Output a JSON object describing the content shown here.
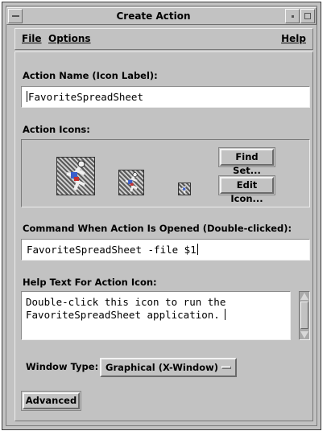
{
  "window": {
    "title": "Create Action"
  },
  "menubar": {
    "file_label": "File",
    "options_label": "Options",
    "help_label": "Help"
  },
  "form": {
    "action_name_label": "Action Name (Icon Label):",
    "action_name_value": "FavoriteSpreadSheet",
    "action_icons_label": "Action Icons:",
    "find_set_button": "Find Set...",
    "edit_icon_button": "Edit Icon...",
    "command_label": "Command When Action Is Opened (Double-clicked):",
    "command_value": "FavoriteSpreadSheet -file $1",
    "help_text_label": "Help Text For Action Icon:",
    "help_text_line1": "Double-click this icon to run the",
    "help_text_line2": "FavoriteSpreadSheet application.",
    "window_type_label": "Window Type:",
    "window_type_value": "Graphical (X-Window)",
    "advanced_button": "Advanced"
  },
  "icons": {
    "large": "runner-icon",
    "medium": "runner-icon",
    "small": "runner-icon"
  }
}
